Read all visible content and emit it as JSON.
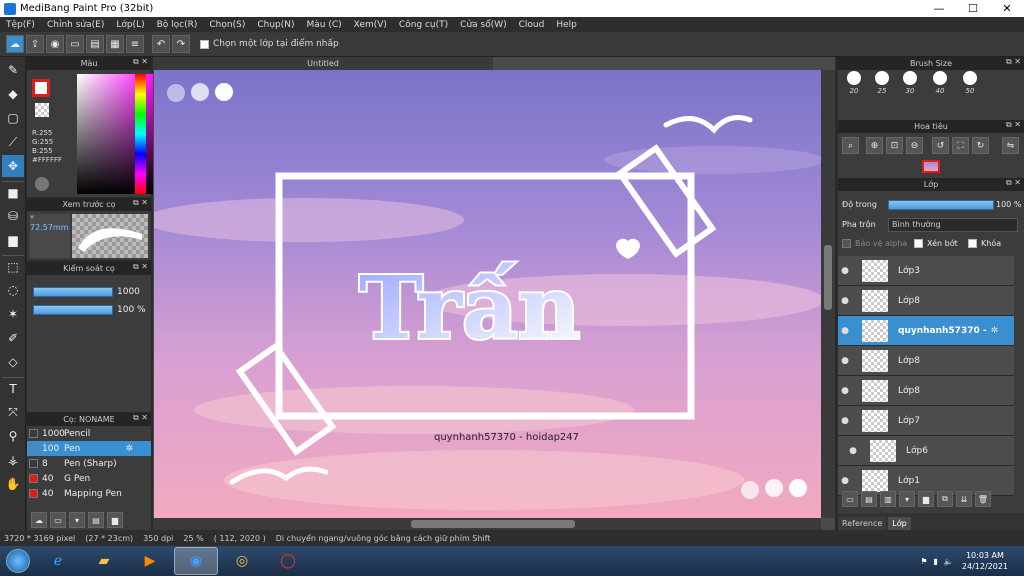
{
  "window": {
    "title": "MediBang Paint Pro (32bit)"
  },
  "menu": [
    "Tệp(F)",
    "Chỉnh sửa(E)",
    "Lớp(L)",
    "Bộ lọc(R)",
    "Chọn(S)",
    "Chụp(N)",
    "Màu (C)",
    "Xem(V)",
    "Công cụ(T)",
    "Cửa sổ(W)",
    "Cloud",
    "Help"
  ],
  "toolbar": {
    "checkbox_label": "Chọn một lớp tại điểm nhấp"
  },
  "document": {
    "tab_title": "Untitled"
  },
  "color_panel": {
    "title": "Màu",
    "r": "R:255",
    "g": "G:255",
    "b": "B:255",
    "hex": "#FFFFFF",
    "fg_color": "#e21b1b"
  },
  "brush_preview": {
    "title": "Xem trước cọ",
    "size": "* 72.57mm"
  },
  "brush_control": {
    "title": "Kiểm soát cọ",
    "size": "1000",
    "opacity": "100 %",
    "size_fraction": 1.0,
    "opacity_fraction": 1.0
  },
  "brush_list": {
    "title": "Cọ: NONAME",
    "items": [
      {
        "size": "1000",
        "name": "Pencil",
        "color": "#3a3a3a",
        "selected": false
      },
      {
        "size": "100",
        "name": "Pen",
        "color": "#3a8fd0",
        "selected": true
      },
      {
        "size": "8",
        "name": "Pen (Sharp)",
        "color": "#3a3a3a",
        "selected": false
      },
      {
        "size": "40",
        "name": "G Pen",
        "color": "#e21b1b",
        "selected": false
      },
      {
        "size": "40",
        "name": "Mapping Pen",
        "color": "#e21b1b",
        "selected": false
      }
    ]
  },
  "brush_size_panel": {
    "title": "Brush Size",
    "sizes": [
      "20",
      "25",
      "30",
      "40",
      "50"
    ]
  },
  "navigator": {
    "title": "Hoa tiêu"
  },
  "layers": {
    "title": "Lớp",
    "opacity_label": "Độ trong",
    "opacity_value": "100 %",
    "opacity_fraction": 1.0,
    "blend_label": "Pha trộn",
    "blend_value": "Bình thường",
    "protect_alpha": "Bảo vệ alpha",
    "clip": "Xén bớt",
    "lock": "Khóa",
    "items": [
      {
        "name": "Lớp3",
        "selected": false,
        "indent": false
      },
      {
        "name": "Lớp8",
        "selected": false,
        "indent": false
      },
      {
        "name": "quynhanh57370 -",
        "selected": true,
        "indent": false
      },
      {
        "name": "Lớp8",
        "selected": false,
        "indent": false
      },
      {
        "name": "Lớp8",
        "selected": false,
        "indent": false
      },
      {
        "name": "Lớp7",
        "selected": false,
        "indent": false
      },
      {
        "name": "Lớp6",
        "selected": false,
        "indent": true
      },
      {
        "name": "Lớp1",
        "selected": false,
        "indent": false
      }
    ]
  },
  "right_tabs": [
    "Reference",
    "Lớp"
  ],
  "status": {
    "pixels": "3720 * 3169 pixel",
    "size": "(27 * 23cm)",
    "dpi": "350 dpi",
    "zoom": "25 %",
    "coords": "( 112, 2020 )",
    "hint": "Di chuyển ngang/vuông góc bằng cách giữ phím Shift"
  },
  "artwork": {
    "main_text": "Trấn",
    "credit": "quynhanh57370 - hoidap247"
  },
  "taskbar": {
    "time": "10:03 AM",
    "date": "24/12/2021"
  }
}
